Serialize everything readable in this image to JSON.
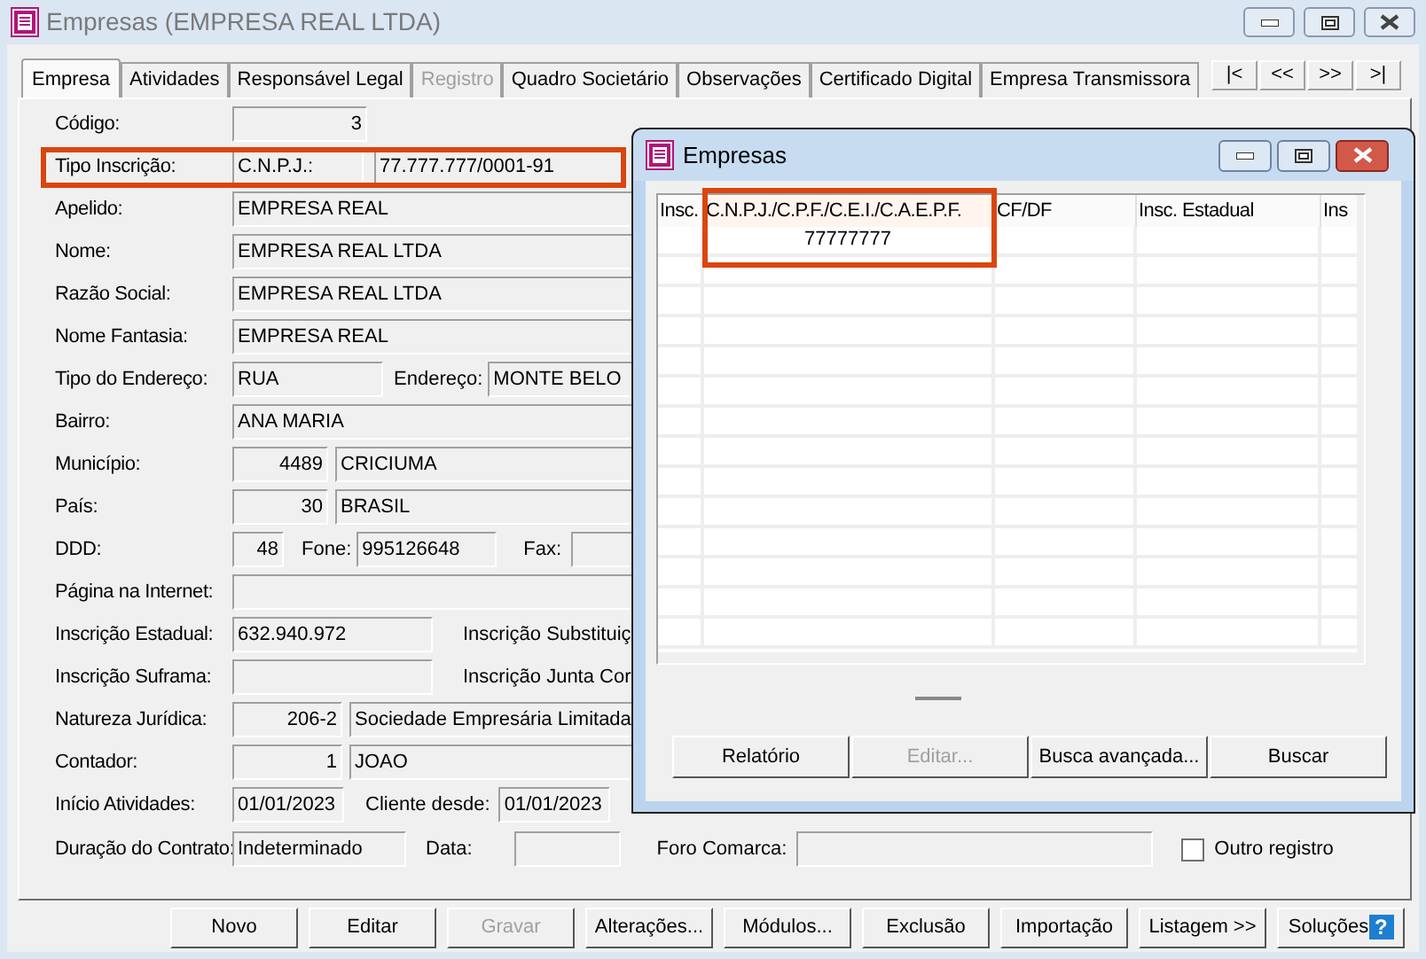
{
  "window": {
    "title": "Empresas (EMPRESA REAL LTDA)"
  },
  "tabs": [
    {
      "label": "Empresa",
      "selected": true,
      "disabled": false
    },
    {
      "label": "Atividades",
      "selected": false,
      "disabled": false
    },
    {
      "label": "Responsável Legal",
      "selected": false,
      "disabled": false
    },
    {
      "label": "Registro",
      "selected": false,
      "disabled": true
    },
    {
      "label": "Quadro Societário",
      "selected": false,
      "disabled": false
    },
    {
      "label": "Observações",
      "selected": false,
      "disabled": false
    },
    {
      "label": "Certificado Digital",
      "selected": false,
      "disabled": false
    },
    {
      "label": "Empresa Transmissora",
      "selected": false,
      "disabled": false
    }
  ],
  "nav_buttons": [
    "|<",
    "<<",
    ">>",
    ">|"
  ],
  "form": {
    "rows": [
      {
        "label": "Código:",
        "items": [
          {
            "kind": "code_field",
            "value": "3"
          }
        ]
      },
      {
        "label": "Tipo Inscrição:",
        "highlighted": true,
        "items": [
          {
            "kind": "field",
            "value": "C.N.P.J.:"
          },
          {
            "kind": "field",
            "value": "77.777.777/0001-91"
          }
        ]
      },
      {
        "label": "Apelido:",
        "items": [
          {
            "kind": "field",
            "value": "EMPRESA REAL"
          }
        ]
      },
      {
        "label": "Nome:",
        "items": [
          {
            "kind": "field",
            "value": "EMPRESA REAL LTDA"
          }
        ]
      },
      {
        "label": "Razão Social:",
        "items": [
          {
            "kind": "field",
            "value": "EMPRESA REAL LTDA"
          }
        ]
      },
      {
        "label": "Nome Fantasia:",
        "items": [
          {
            "kind": "field",
            "value": "EMPRESA REAL"
          }
        ]
      },
      {
        "label": "Tipo do Endereço:",
        "items": [
          {
            "kind": "field",
            "value": "RUA"
          },
          {
            "kind": "label",
            "text": "Endereço:"
          },
          {
            "kind": "field",
            "value": "MONTE BELO"
          }
        ]
      },
      {
        "label": "Bairro:",
        "items": [
          {
            "kind": "field",
            "value": "ANA MARIA"
          }
        ]
      },
      {
        "label": "Município:",
        "items": [
          {
            "kind": "code_field",
            "value": "4489"
          },
          {
            "kind": "field",
            "value": "CRICIUMA"
          }
        ]
      },
      {
        "label": "País:",
        "items": [
          {
            "kind": "code_field",
            "value": "30"
          },
          {
            "kind": "field",
            "value": "BRASIL"
          }
        ]
      },
      {
        "label": "DDD:",
        "items": [
          {
            "kind": "code_field",
            "value": "48"
          },
          {
            "kind": "label",
            "text": "Fone:"
          },
          {
            "kind": "field",
            "value": "995126648"
          },
          {
            "kind": "label",
            "text": "Fax:"
          },
          {
            "kind": "field"
          }
        ]
      },
      {
        "label": "Página na Internet:",
        "items": [
          {
            "kind": "field"
          }
        ]
      },
      {
        "label": "Inscrição Estadual:",
        "items": [
          {
            "kind": "field",
            "value": "632.940.972"
          },
          {
            "kind": "label",
            "text": "Inscrição Substituiç"
          }
        ]
      },
      {
        "label": "Inscrição Suframa:",
        "items": [
          {
            "kind": "field"
          },
          {
            "kind": "label",
            "text": "Inscrição Junta Cor"
          }
        ]
      },
      {
        "label": "Natureza Jurídica:",
        "items": [
          {
            "kind": "code_field",
            "value": "206-2"
          },
          {
            "kind": "field",
            "value": "Sociedade Empresária Limitada"
          }
        ]
      },
      {
        "label": "Contador:",
        "items": [
          {
            "kind": "code_field",
            "value": "1"
          },
          {
            "kind": "field",
            "value": "JOAO"
          }
        ]
      },
      {
        "label": "Início Atividades:",
        "items": [
          {
            "kind": "field",
            "value": "01/01/2023"
          },
          {
            "kind": "label",
            "text": "Cliente desde:"
          },
          {
            "kind": "field",
            "value": "01/01/2023"
          }
        ]
      },
      {
        "label": "Duração do Contrato:",
        "items": [
          {
            "kind": "field",
            "value": "Indeterminado"
          },
          {
            "kind": "label",
            "text": "Data:"
          },
          {
            "kind": "field"
          },
          {
            "kind": "label",
            "text": "Foro Comarca:"
          },
          {
            "kind": "field"
          },
          {
            "kind": "checkbox",
            "text": "Outro registro",
            "checked": false
          }
        ]
      }
    ]
  },
  "dialog": {
    "title": "Empresas",
    "table": {
      "columns": [
        {
          "label": "Insc.",
          "highlighted": false
        },
        {
          "label": "C.N.P.J./C.P.F./C.E.I./C.A.E.P.F.",
          "highlighted": true
        },
        {
          "label": "CF/DF",
          "highlighted": false
        },
        {
          "label": "Insc. Estadual",
          "highlighted": false
        },
        {
          "label": "Ins",
          "highlighted": false
        }
      ],
      "rows": [
        {
          "cnpj": "77777777"
        }
      ]
    },
    "buttons": [
      {
        "label": "Relatório",
        "disabled": false
      },
      {
        "label": "Editar...",
        "disabled": true
      },
      {
        "label": "Busca avançada...",
        "disabled": false
      },
      {
        "label": "Buscar",
        "disabled": false
      }
    ]
  },
  "buttons": [
    {
      "label": "Novo",
      "disabled": false
    },
    {
      "label": "Editar",
      "disabled": false
    },
    {
      "label": "Gravar",
      "disabled": true
    },
    {
      "label": "Alterações...",
      "disabled": false
    },
    {
      "label": "Módulos...",
      "disabled": false
    },
    {
      "label": "Exclusão",
      "disabled": false
    },
    {
      "label": "Importação",
      "disabled": false
    },
    {
      "label": "Listagem >>",
      "disabled": false
    },
    {
      "label": "Soluções",
      "badge": "?",
      "disabled": false
    }
  ]
}
